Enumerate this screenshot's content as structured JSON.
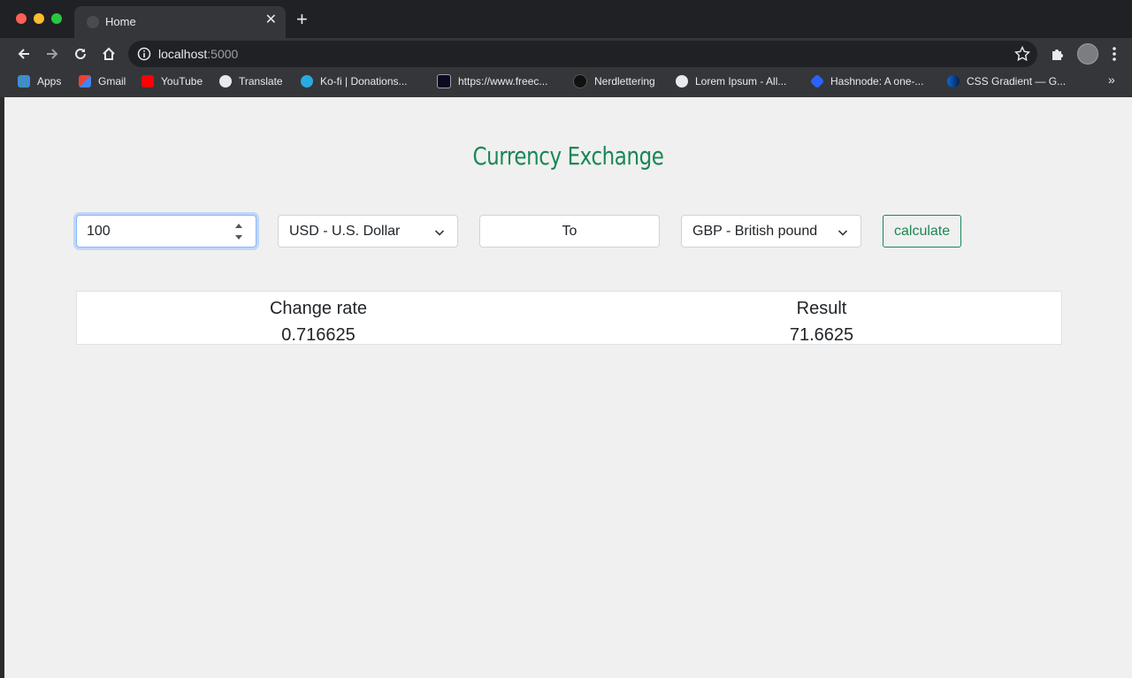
{
  "browser": {
    "tab_title": "Home",
    "url_host": "localhost",
    "url_port": ":5000",
    "bookmarks": [
      {
        "label": "Apps",
        "icon": "apps-grid-icon",
        "color": "#4285f4"
      },
      {
        "label": "Gmail",
        "icon": "gmail-icon",
        "color": "#ea4335"
      },
      {
        "label": "YouTube",
        "icon": "youtube-icon",
        "color": "#ff0000"
      },
      {
        "label": "Translate",
        "icon": "globe-icon",
        "color": "#e8eaed"
      },
      {
        "label": "Ko-fi | Donations...",
        "icon": "kofi-icon",
        "color": "#29abe0"
      },
      {
        "label": "https://www.freec...",
        "icon": "freecodecamp-icon",
        "color": "#0a0a23"
      },
      {
        "label": "Nerdlettering",
        "icon": "nerdlettering-icon",
        "color": "#111111"
      },
      {
        "label": "Lorem Ipsum - All...",
        "icon": "globe-icon",
        "color": "#e8eaed"
      },
      {
        "label": "Hashnode: A one-...",
        "icon": "hashnode-icon",
        "color": "#2962ff"
      },
      {
        "label": "CSS Gradient — G...",
        "icon": "css-gradient-icon",
        "color": "#0b6ad8"
      }
    ],
    "more_bookmarks": "»"
  },
  "app": {
    "title": "Currency Exchange",
    "accent": "#198754",
    "amount": "100",
    "from_currency": "USD - U.S. Dollar",
    "to_label": "To",
    "to_currency": "GBP - British pound",
    "calculate_label": "calculate",
    "rate_label": "Change rate",
    "rate_value": "0.716625",
    "result_label": "Result",
    "result_value": "71.6625"
  }
}
